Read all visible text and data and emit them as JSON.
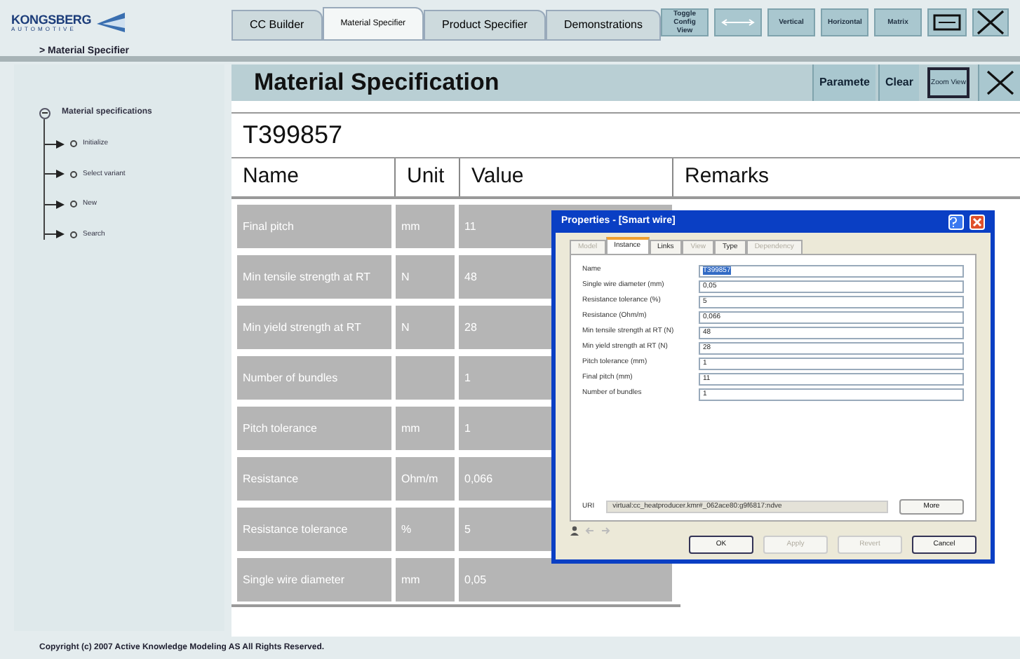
{
  "logo": {
    "name": "KONGSBERG",
    "tagline": "AUTOMOTIVE"
  },
  "tabs": [
    {
      "label": "CC Builder",
      "selected": false
    },
    {
      "label": "Material Specifier",
      "selected": true
    },
    {
      "label": "Product Specifier",
      "selected": false
    },
    {
      "label": "Demonstrations",
      "selected": false
    }
  ],
  "toolbar": [
    {
      "kind": "text",
      "label": "Toggle Config View"
    },
    {
      "kind": "arrow"
    },
    {
      "kind": "text",
      "label": "Vertical"
    },
    {
      "kind": "text",
      "label": "Horizontal"
    },
    {
      "kind": "text",
      "label": "Matrix"
    },
    {
      "kind": "frame"
    },
    {
      "kind": "close"
    }
  ],
  "breadcrumb": "> Material Specifier",
  "tree": {
    "label": "Material specifications",
    "expanded": true,
    "children": [
      {
        "label": "Initialize"
      },
      {
        "label": "Select variant"
      },
      {
        "label": "New"
      },
      {
        "label": "Search"
      }
    ]
  },
  "panel": {
    "title": "Material Specification",
    "buttons": [
      {
        "kind": "text",
        "label": "Paramete"
      },
      {
        "kind": "text",
        "label": "Clear"
      },
      {
        "kind": "framed",
        "label": "Zoom View"
      },
      {
        "kind": "close"
      }
    ]
  },
  "item_id": "T399857",
  "table": {
    "columns": [
      "Name",
      "Unit",
      "Value",
      "Remarks"
    ],
    "rows": [
      {
        "name": "Final pitch",
        "unit": "mm",
        "value": "11"
      },
      {
        "name": "Min tensile strength at RT",
        "unit": "N",
        "value": "48"
      },
      {
        "name": "Min yield strength at RT",
        "unit": "N",
        "value": "28"
      },
      {
        "name": "Number of bundles",
        "unit": "",
        "value": "1"
      },
      {
        "name": "Pitch tolerance",
        "unit": "mm",
        "value": "1"
      },
      {
        "name": "Resistance",
        "unit": "Ohm/m",
        "value": "0,066"
      },
      {
        "name": "Resistance tolerance",
        "unit": "%",
        "value": "5"
      },
      {
        "name": "Single wire diameter",
        "unit": "mm",
        "value": "0,05"
      }
    ]
  },
  "dialog": {
    "title": "Properties - [Smart wire]",
    "tabs": [
      {
        "label": "Model",
        "selected": false,
        "disabled": true
      },
      {
        "label": "Instance",
        "selected": true,
        "disabled": false
      },
      {
        "label": "Links",
        "selected": false,
        "disabled": false
      },
      {
        "label": "View",
        "selected": false,
        "disabled": true
      },
      {
        "label": "Type",
        "selected": false,
        "disabled": false
      },
      {
        "label": "Dependency",
        "selected": false,
        "disabled": true
      }
    ],
    "fields": [
      {
        "label": "Name",
        "value": "T399857",
        "selected": true
      },
      {
        "label": "Single wire diameter (mm)",
        "value": "0,05",
        "selected": false
      },
      {
        "label": "Resistance tolerance (%)",
        "value": "5",
        "selected": false
      },
      {
        "label": "Resistance (Ohm/m)",
        "value": "0,066",
        "selected": false
      },
      {
        "label": "Min tensile strength at RT (N)",
        "value": "48",
        "selected": false
      },
      {
        "label": "Min yield strength at RT (N)",
        "value": "28",
        "selected": false
      },
      {
        "label": "Pitch tolerance (mm)",
        "value": "1",
        "selected": false
      },
      {
        "label": "Final pitch (mm)",
        "value": "11",
        "selected": false
      },
      {
        "label": "Number of bundles",
        "value": "1",
        "selected": false
      }
    ],
    "uri_label": "URI",
    "uri": "virtual:cc_heatproducer.kmr#_062ace80:g9f6817:ndve",
    "more": "More",
    "buttons": [
      {
        "label": "OK",
        "disabled": false
      },
      {
        "label": "Apply",
        "disabled": true
      },
      {
        "label": "Revert",
        "disabled": true
      },
      {
        "label": "Cancel",
        "disabled": false
      }
    ]
  },
  "footer": "Copyright (c) 2007 Active Knowledge Modeling AS All Rights Reserved."
}
